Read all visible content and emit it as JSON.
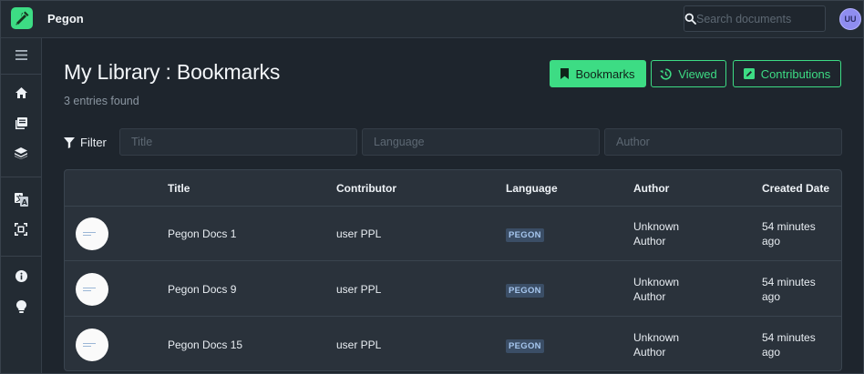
{
  "app": {
    "name": "Pegon",
    "user_initials": "UU"
  },
  "search": {
    "placeholder": "Search documents"
  },
  "sidebar": {
    "items": [
      {
        "name": "menu-icon"
      },
      {
        "name": "home-icon"
      },
      {
        "name": "book-icon"
      },
      {
        "name": "layers-icon"
      },
      {
        "name": "translate-icon"
      },
      {
        "name": "scan-icon"
      },
      {
        "name": "info-icon"
      },
      {
        "name": "lightbulb-icon"
      }
    ]
  },
  "page": {
    "title": "My Library : Bookmarks",
    "entry_count": "3 entries found"
  },
  "tabs": {
    "bookmarks": "Bookmarks",
    "viewed": "Viewed",
    "contributions": "Contributions"
  },
  "filter": {
    "label": "Filter",
    "title_placeholder": "Title",
    "language_placeholder": "Language",
    "author_placeholder": "Author"
  },
  "table": {
    "headers": {
      "title": "Title",
      "contributor": "Contributor",
      "language": "Language",
      "author": "Author",
      "created": "Created Date"
    },
    "rows": [
      {
        "title": "Pegon Docs 1",
        "contributor": "user PPL",
        "language": "PEGON",
        "author_line1": "Unknown",
        "author_line2": "Author",
        "created_line1": "54 minutes",
        "created_line2": "ago"
      },
      {
        "title": "Pegon Docs 9",
        "contributor": "user PPL",
        "language": "PEGON",
        "author_line1": "Unknown",
        "author_line2": "Author",
        "created_line1": "54 minutes",
        "created_line2": "ago"
      },
      {
        "title": "Pegon Docs 15",
        "contributor": "user PPL",
        "language": "PEGON",
        "author_line1": "Unknown",
        "author_line2": "Author",
        "created_line1": "54 minutes",
        "created_line2": "ago"
      }
    ]
  },
  "colors": {
    "accent": "#3ddc84",
    "background": "#1e252d",
    "panel": "#2a323b",
    "badge_bg": "#3b4e66"
  }
}
